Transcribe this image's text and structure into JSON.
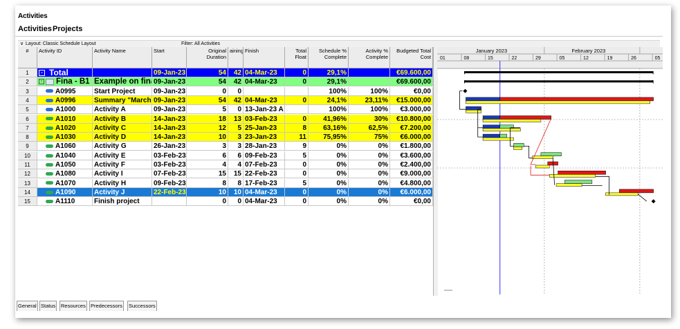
{
  "window_title": "Activities",
  "tabs": [
    "Activities",
    "Projects"
  ],
  "layout_label": "Layout: Classic Schedule Layout",
  "filter_label": "Filter: All Activities",
  "columns": {
    "num": "#",
    "id": "Activity ID",
    "name": "Activity Name",
    "start": "Start",
    "orig_dur": "Original Duration",
    "rem": "aining",
    "finish": "Finish",
    "float": "Total Float",
    "sched": "Schedule % Complete",
    "act": "Activity % Complete",
    "cost": "Budgeted Total Cost"
  },
  "gantt_months": [
    "January 2023",
    "February 2023"
  ],
  "gantt_days": [
    "01",
    "08",
    "15",
    "22",
    "29",
    "05",
    "12",
    "19",
    "26",
    "05"
  ],
  "rows": [
    {
      "n": "1",
      "id": "Total",
      "name": "",
      "start": "09-Jan-23 A",
      "od": "54",
      "rd": "42",
      "finish": "04-Mar-23",
      "tf": "0",
      "sc": "29,1%",
      "ac": "",
      "cost": "€69.600,00"
    },
    {
      "n": "2",
      "id": "Fina - B1",
      "name": "Example on financ",
      "start": "09-Jan-23 A",
      "od": "54",
      "rd": "42",
      "finish": "04-Mar-23",
      "tf": "0",
      "sc": "29,1%",
      "ac": "",
      "cost": "€69.600,00"
    },
    {
      "n": "3",
      "id": "A0995",
      "name": "Start Project",
      "start": "09-Jan-23 A",
      "od": "0",
      "rd": "0",
      "finish": "",
      "tf": "",
      "sc": "100%",
      "ac": "100%",
      "cost": "€0,00"
    },
    {
      "n": "4",
      "id": "A0996",
      "name": "Summary \"Marching",
      "start": "09-Jan-23 A",
      "od": "54",
      "rd": "42",
      "finish": "04-Mar-23",
      "tf": "0",
      "sc": "24,1%",
      "ac": "23,11%",
      "cost": "€15.000,00"
    },
    {
      "n": "5",
      "id": "A1000",
      "name": "Activity A",
      "start": "09-Jan-23 A",
      "od": "5",
      "rd": "0",
      "finish": "13-Jan-23 A",
      "tf": "",
      "sc": "100%",
      "ac": "100%",
      "cost": "€3.000,00"
    },
    {
      "n": "6",
      "id": "A1010",
      "name": "Activity B",
      "start": "14-Jan-23 A",
      "od": "18",
      "rd": "13",
      "finish": "03-Feb-23",
      "tf": "0",
      "sc": "41,96%",
      "ac": "30%",
      "cost": "€10.800,00"
    },
    {
      "n": "7",
      "id": "A1020",
      "name": "Activity C",
      "start": "14-Jan-23 A",
      "od": "12",
      "rd": "5",
      "finish": "25-Jan-23",
      "tf": "8",
      "sc": "63,16%",
      "ac": "62,5%",
      "cost": "€7.200,00"
    },
    {
      "n": "8",
      "id": "A1030",
      "name": "Activity D",
      "start": "14-Jan-23 A",
      "od": "10",
      "rd": "3",
      "finish": "23-Jan-23",
      "tf": "11",
      "sc": "75,95%",
      "ac": "75%",
      "cost": "€6.000,00"
    },
    {
      "n": "9",
      "id": "A1060",
      "name": "Activity G",
      "start": "26-Jan-23",
      "od": "3",
      "rd": "3",
      "finish": "28-Jan-23",
      "tf": "9",
      "sc": "0%",
      "ac": "0%",
      "cost": "€1.800,00"
    },
    {
      "n": "10",
      "id": "A1040",
      "name": "Activity E",
      "start": "03-Feb-23",
      "od": "6",
      "rd": "6",
      "finish": "09-Feb-23",
      "tf": "5",
      "sc": "0%",
      "ac": "0%",
      "cost": "€3.600,00"
    },
    {
      "n": "11",
      "id": "A1050",
      "name": "Activity F",
      "start": "03-Feb-23",
      "od": "4",
      "rd": "4",
      "finish": "07-Feb-23",
      "tf": "0",
      "sc": "0%",
      "ac": "0%",
      "cost": "€2.400,00"
    },
    {
      "n": "12",
      "id": "A1080",
      "name": "Activity I",
      "start": "07-Feb-23",
      "od": "15",
      "rd": "15",
      "finish": "22-Feb-23",
      "tf": "0",
      "sc": "0%",
      "ac": "0%",
      "cost": "€9.000,00"
    },
    {
      "n": "13",
      "id": "A1070",
      "name": "Activity H",
      "start": "09-Feb-23",
      "od": "8",
      "rd": "8",
      "finish": "17-Feb-23",
      "tf": "5",
      "sc": "0%",
      "ac": "0%",
      "cost": "€4.800,00"
    },
    {
      "n": "14",
      "id": "A1090",
      "name": "Activity J",
      "start": "22-Feb-23",
      "od": "10",
      "rd": "10",
      "finish": "04-Mar-23",
      "tf": "0",
      "sc": "0%",
      "ac": "0%",
      "cost": "€6.000,00"
    },
    {
      "n": "15",
      "id": "A1110",
      "name": "Finish project",
      "start": "",
      "od": "0",
      "rd": "0",
      "finish": "04-Mar-23",
      "tf": "0",
      "sc": "0%",
      "ac": "0%",
      "cost": "€0,00"
    }
  ],
  "row_styles": [
    "total",
    "wbs",
    "plain",
    "yellow",
    "plain",
    "yellow",
    "yellow",
    "yellow",
    "plain",
    "plain",
    "plain",
    "plain",
    "plain",
    "selected",
    "plain"
  ],
  "bottom_tabs": [
    "General",
    "Status",
    "Resources",
    "Predecessors",
    "Successors"
  ],
  "colors": {
    "total_bg": "#0000ff",
    "total_fg": "#ffffff",
    "total_num": "#ffff00",
    "wbs_bg": "#80ff80",
    "yellow_bg": "#ffff00",
    "selected_bg": "#1a7ad4",
    "selected_fg": "#ffffff",
    "bar_blue": "#1a3ab8",
    "bar_yellow": "#ffff33",
    "bar_red": "#e01818",
    "bar_green": "#80e080",
    "today_line": "#3030ff"
  }
}
